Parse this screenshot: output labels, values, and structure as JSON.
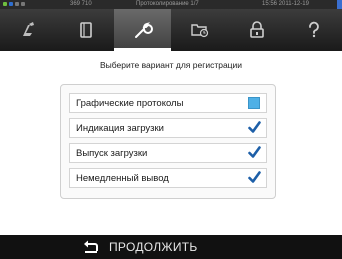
{
  "status_bar": {
    "counter": "369 710",
    "title": "Протоколирование 1/7",
    "datetime": "15:56 2011-12-19"
  },
  "tabs": [
    {
      "name": "program",
      "icon": "program-icon",
      "active": false
    },
    {
      "name": "document",
      "icon": "document-icon",
      "active": false
    },
    {
      "name": "settings",
      "icon": "wrench-icon",
      "active": true
    },
    {
      "name": "setup",
      "icon": "folder-clock-icon",
      "active": false
    },
    {
      "name": "lock",
      "icon": "lock-icon",
      "active": false
    },
    {
      "name": "help",
      "icon": "help-icon",
      "active": false
    }
  ],
  "prompt": "Выберите вариант для регистрации",
  "options": [
    {
      "label": "Графические протоколы",
      "checked": false
    },
    {
      "label": "Индикация загрузки",
      "checked": true
    },
    {
      "label": "Выпуск загрузки",
      "checked": true
    },
    {
      "label": "Немедленный вывод",
      "checked": true
    }
  ],
  "footer": {
    "continue_label": "ПРОДОЛЖИТЬ",
    "icon": "return-arrow-icon"
  },
  "colors": {
    "unchecked_box": "#4fb0e6",
    "checkmark": "#1d5fa8",
    "tab_bar": "#2b2b2b"
  }
}
